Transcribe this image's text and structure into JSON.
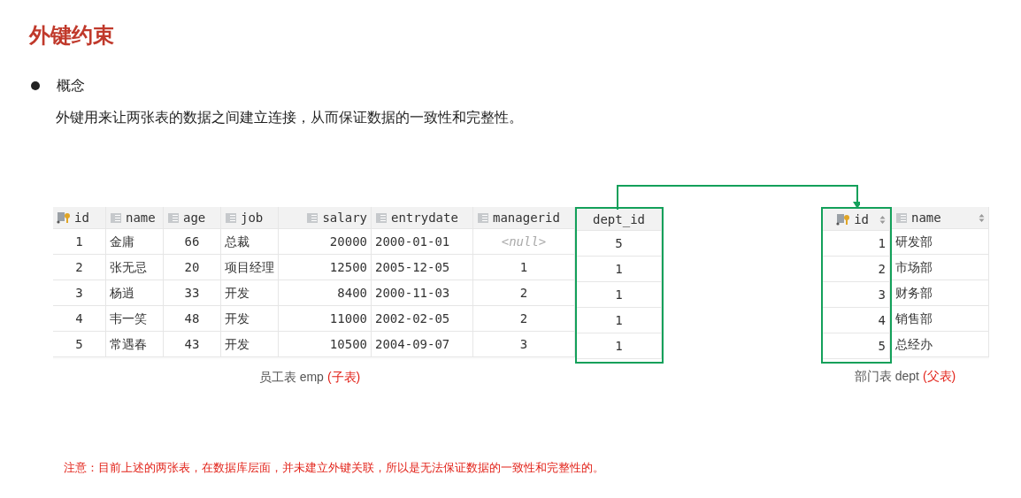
{
  "title": "外键约束",
  "bullet": {
    "label": "概念",
    "text": "外键用来让两张表的数据之间建立连接，从而保证数据的一致性和完整性。"
  },
  "tables": [
    {
      "caption_name": "员工表 emp",
      "caption_role": "(子表)",
      "sortable": false,
      "columns": [
        {
          "name": "id",
          "kind": "key",
          "highlighted": false
        },
        {
          "name": "name",
          "kind": "column",
          "highlighted": false
        },
        {
          "name": "age",
          "kind": "column",
          "highlighted": false
        },
        {
          "name": "job",
          "kind": "column",
          "highlighted": false
        },
        {
          "name": "salary",
          "kind": "column",
          "highlighted": false
        },
        {
          "name": "entrydate",
          "kind": "column",
          "highlighted": false
        },
        {
          "name": "managerid",
          "kind": "column",
          "highlighted": false
        },
        {
          "name": "dept_id",
          "kind": "plain",
          "highlighted": true
        }
      ],
      "rows": [
        [
          "1",
          "金庸",
          "66",
          "总裁",
          "20000",
          "2000-01-01",
          {
            "value": "<null>",
            "kind": "null"
          },
          "5"
        ],
        [
          "2",
          "张无忌",
          "20",
          "项目经理",
          "12500",
          "2005-12-05",
          "1",
          "1"
        ],
        [
          "3",
          "杨逍",
          "33",
          "开发",
          "8400",
          "2000-11-03",
          "2",
          "1"
        ],
        [
          "4",
          "韦一笑",
          "48",
          "开发",
          "11000",
          "2002-02-05",
          "2",
          "1"
        ],
        [
          "5",
          "常遇春",
          "43",
          "开发",
          "10500",
          "2004-09-07",
          "3",
          "1"
        ]
      ]
    },
    {
      "caption_name": "部门表 dept",
      "caption_role": "(父表)",
      "sortable": true,
      "columns": [
        {
          "name": "id",
          "kind": "key",
          "highlighted": true
        },
        {
          "name": "name",
          "kind": "column",
          "highlighted": false
        }
      ],
      "rows": [
        [
          "1",
          "研发部"
        ],
        [
          "2",
          "市场部"
        ],
        [
          "3",
          "财务部"
        ],
        [
          "4",
          "销售部"
        ],
        [
          "5",
          "总经办"
        ]
      ]
    }
  ],
  "note": "注意：目前上述的两张表，在数据库层面，并未建立外键关联，所以是无法保证数据的一致性和完整性的。"
}
